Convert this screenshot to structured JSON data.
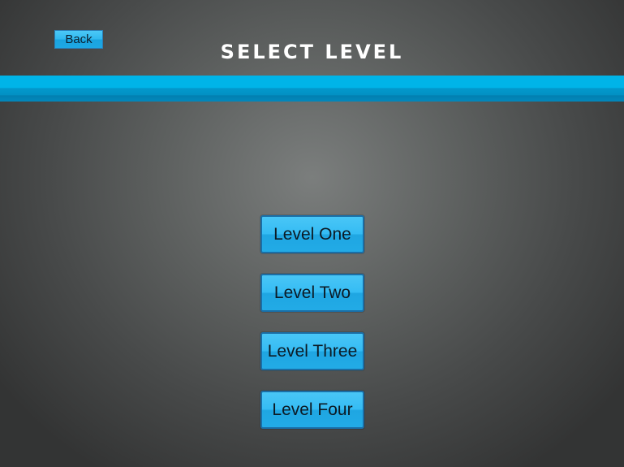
{
  "header": {
    "back_label": "Back",
    "title": "SELECT LEVEL",
    "accent_color": "#00b4e8"
  },
  "levels": [
    {
      "label": "Level One"
    },
    {
      "label": "Level Two"
    },
    {
      "label": "Level Three"
    },
    {
      "label": "Level Four"
    }
  ],
  "colors": {
    "button": "#35bcf4",
    "button_border": "#1a6ea6",
    "background": "#5e6160"
  }
}
